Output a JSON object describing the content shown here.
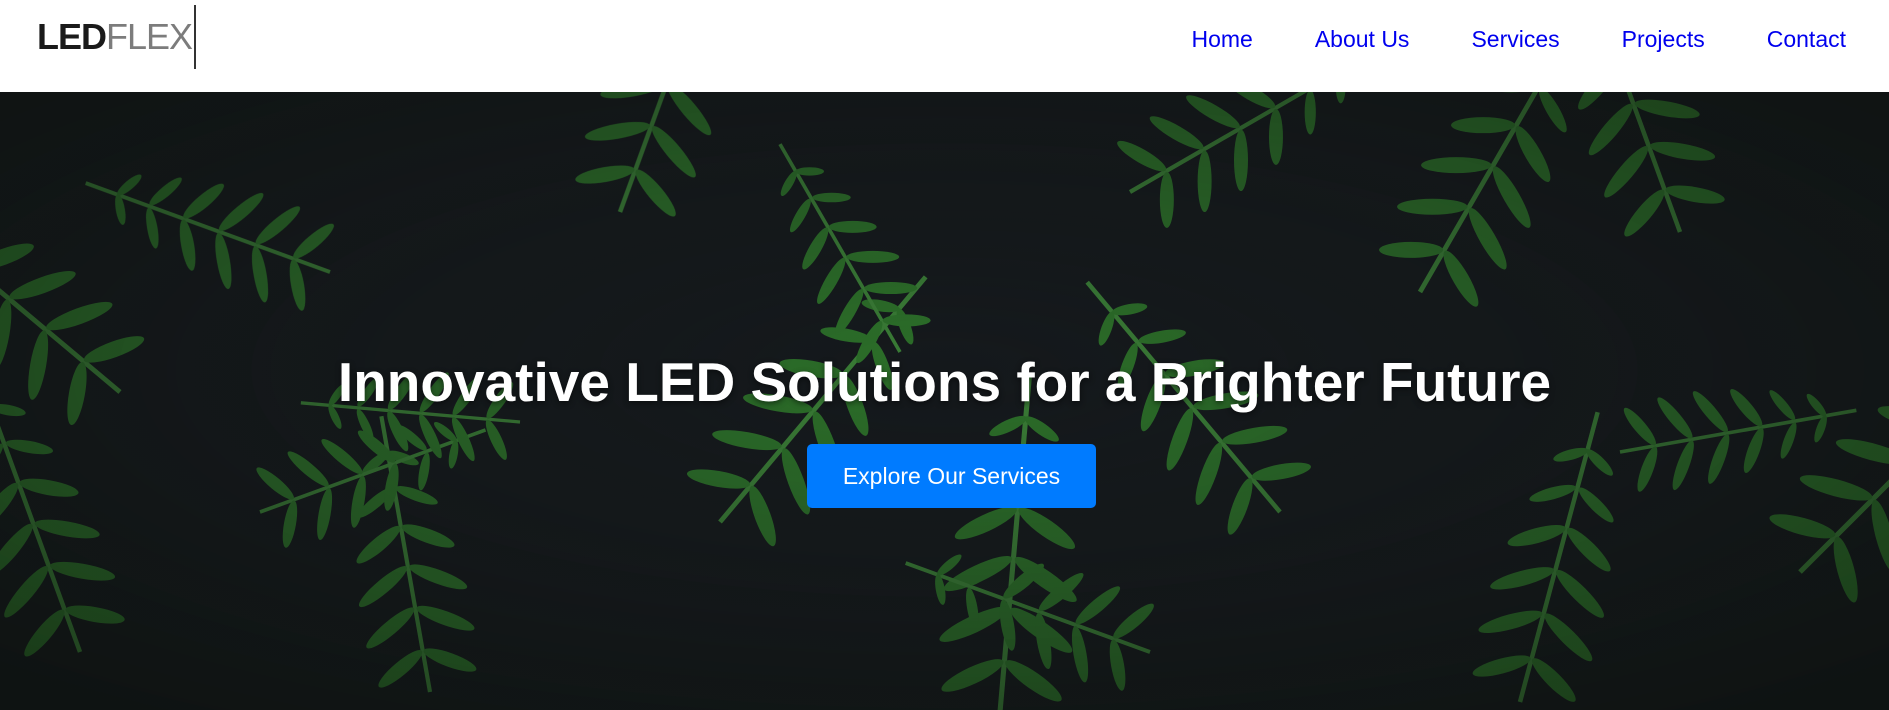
{
  "brand": {
    "logo_bold": "LED",
    "logo_light": "FLEX"
  },
  "nav": {
    "items": [
      {
        "label": "Home"
      },
      {
        "label": "About Us"
      },
      {
        "label": "Services"
      },
      {
        "label": "Projects"
      },
      {
        "label": "Contact"
      }
    ],
    "link_color": "#0000ee"
  },
  "hero": {
    "title": "Innovative LED Solutions for a Brighter Future",
    "cta_label": "Explore Our Services",
    "cta_color": "#007bff",
    "background": "fern-leaves-image"
  }
}
